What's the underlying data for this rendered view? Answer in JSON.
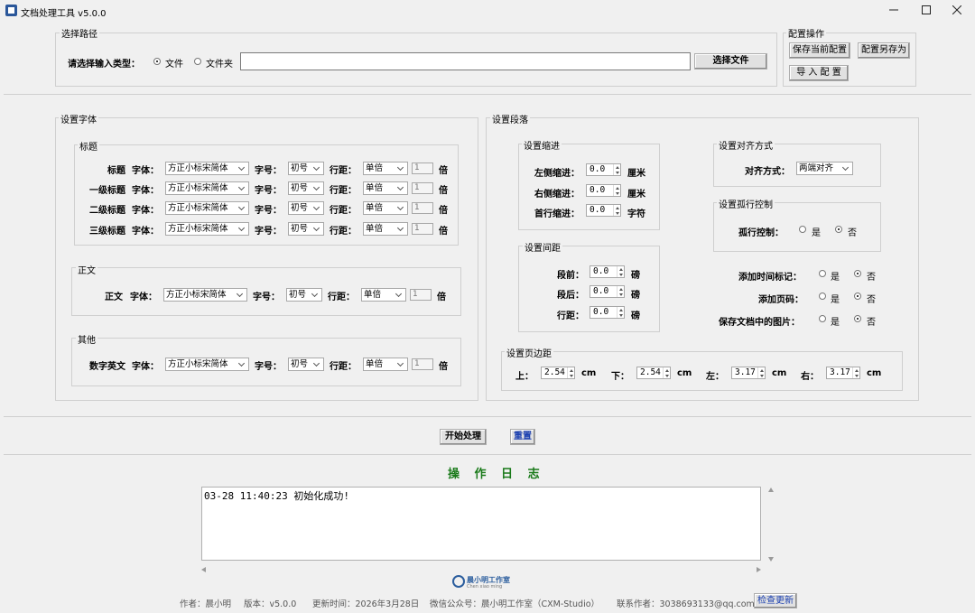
{
  "window": {
    "title": "文档处理工具 v5.0.0",
    "minimize": "—",
    "maximize": "☐",
    "close": "✕"
  },
  "path": {
    "group": "选择路径",
    "prompt": "请选择输入类型：",
    "opt_file": "文件",
    "opt_folder": "文件夹",
    "selected": "file",
    "input_value": "",
    "select_button": "选择文件"
  },
  "config": {
    "group": "配置操作",
    "save_current": "保存当前配置",
    "save_as": "配置另存为",
    "import": "导 入 配 置"
  },
  "font": {
    "group": "设置字体",
    "heading_group": "标题",
    "body_group": "正文",
    "other_group": "其他",
    "font_label": "字体：",
    "size_label": "字号：",
    "spacing_label": "行距：",
    "multiple": "倍",
    "rows": [
      {
        "name": "标题",
        "font": "方正小标宋简体",
        "size": "初号",
        "spacing": "单倍",
        "multiplier": "1"
      },
      {
        "name": "一级标题",
        "font": "方正小标宋简体",
        "size": "初号",
        "spacing": "单倍",
        "multiplier": "1"
      },
      {
        "name": "二级标题",
        "font": "方正小标宋简体",
        "size": "初号",
        "spacing": "单倍",
        "multiplier": "1"
      },
      {
        "name": "三级标题",
        "font": "方正小标宋简体",
        "size": "初号",
        "spacing": "单倍",
        "multiplier": "1"
      }
    ],
    "body": {
      "name": "正文",
      "font": "方正小标宋简体",
      "size": "初号",
      "spacing": "单倍",
      "multiplier": "1"
    },
    "other": {
      "name": "数字英文",
      "font": "方正小标宋简体",
      "size": "初号",
      "spacing": "单倍",
      "multiplier": "1"
    }
  },
  "paragraph": {
    "group": "设置段落",
    "indent": {
      "group": "设置缩进",
      "left_label": "左侧缩进：",
      "left_value": "0.0",
      "left_unit": "厘米",
      "right_label": "右侧缩进：",
      "right_value": "0.0",
      "right_unit": "厘米",
      "first_label": "首行缩进：",
      "first_value": "0.0",
      "first_unit": "字符"
    },
    "spacing": {
      "group": "设置间距",
      "before_label": "段前：",
      "before_value": "0.0",
      "before_unit": "磅",
      "after_label": "段后：",
      "after_value": "0.0",
      "after_unit": "磅",
      "line_label": "行距：",
      "line_value": "0.0",
      "line_unit": "磅"
    },
    "align": {
      "group": "设置对齐方式",
      "label": "对齐方式：",
      "value": "两端对齐"
    },
    "orphan": {
      "group": "设置孤行控制",
      "label": "孤行控制：",
      "yes": "是",
      "no": "否",
      "selected": "no"
    },
    "timestamp": {
      "label": "添加时间标记：",
      "yes": "是",
      "no": "否",
      "selected": "no"
    },
    "page_number": {
      "label": "添加页码：",
      "yes": "是",
      "no": "否",
      "selected": "no"
    },
    "save_images": {
      "label": "保存文档中的图片：",
      "yes": "是",
      "no": "否",
      "selected": "no"
    },
    "margins": {
      "group": "设置页边距",
      "top_label": "上：",
      "top_value": "2.54",
      "bottom_label": "下：",
      "bottom_value": "2.54",
      "left_label": "左：",
      "left_value": "3.17",
      "right_label": "右：",
      "right_value": "3.17",
      "unit": "cm"
    }
  },
  "actions": {
    "start": "开始处理",
    "reset": "重置"
  },
  "log": {
    "title": "操 作 日 志",
    "lines": [
      "03-28 11:40:23    初始化成功!"
    ]
  },
  "footer": {
    "logo_text": "晨小明工作室",
    "logo_sub": "Chen xiao ming",
    "author": "作者：晨小明",
    "version": "版本：v5.0.0",
    "updated": "更新时间：2026年3月28日",
    "wechat": "微信公众号：晨小明工作室（CXM-Studio）",
    "contact": "联系作者：3038693133@qq.com",
    "check_update": "检查更新"
  }
}
